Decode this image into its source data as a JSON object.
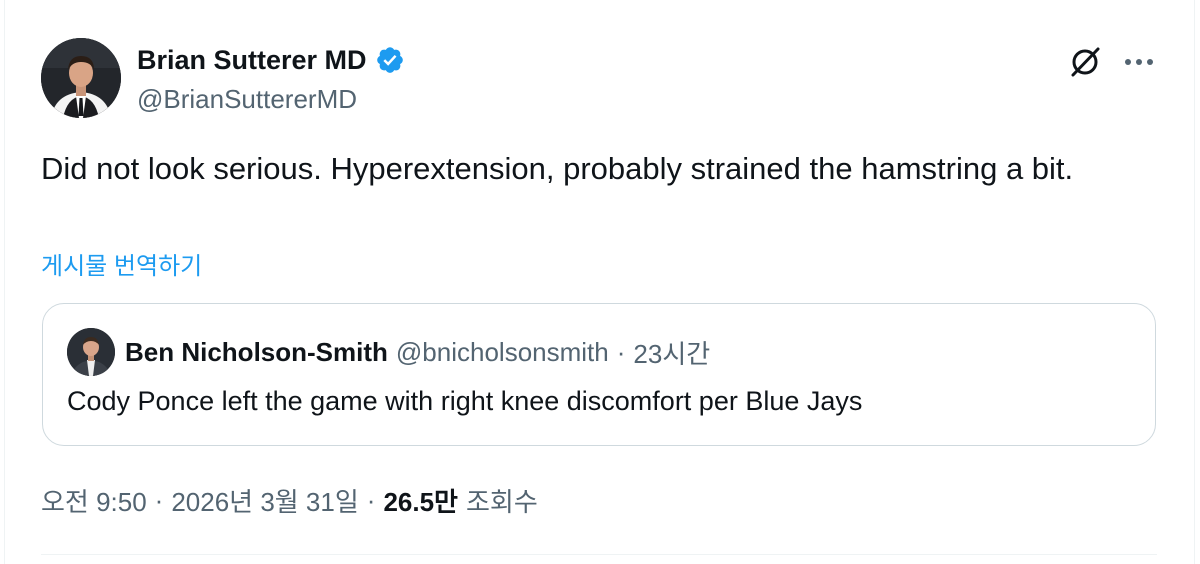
{
  "author": {
    "name": "Brian Sutterer MD",
    "handle": "@BrianSuttererMD",
    "verified": true,
    "verified_color": "#1d9bf0"
  },
  "toolbar": {
    "grok_icon": "slashed-circle-icon",
    "more_icon": "more-horizontal-icon"
  },
  "post": {
    "text": "Did not look serious. Hyperextension, probably strained the hamstring a bit.",
    "translate_label": "게시물 번역하기"
  },
  "quote": {
    "name": "Ben Nicholson-Smith",
    "handle": "@bnicholsonsmith",
    "separator": "·",
    "time": "23시간",
    "text": "Cody Ponce left the game with right knee discomfort per Blue Jays"
  },
  "meta": {
    "time": "오전 9:50",
    "separator": "·",
    "date": "2026년 3월 31일",
    "views_count": "26.5만",
    "views_label": "조회수"
  },
  "colors": {
    "text_primary": "#0f1419",
    "text_secondary": "#536471",
    "link": "#1d9bf0",
    "border": "#cfd9de"
  }
}
